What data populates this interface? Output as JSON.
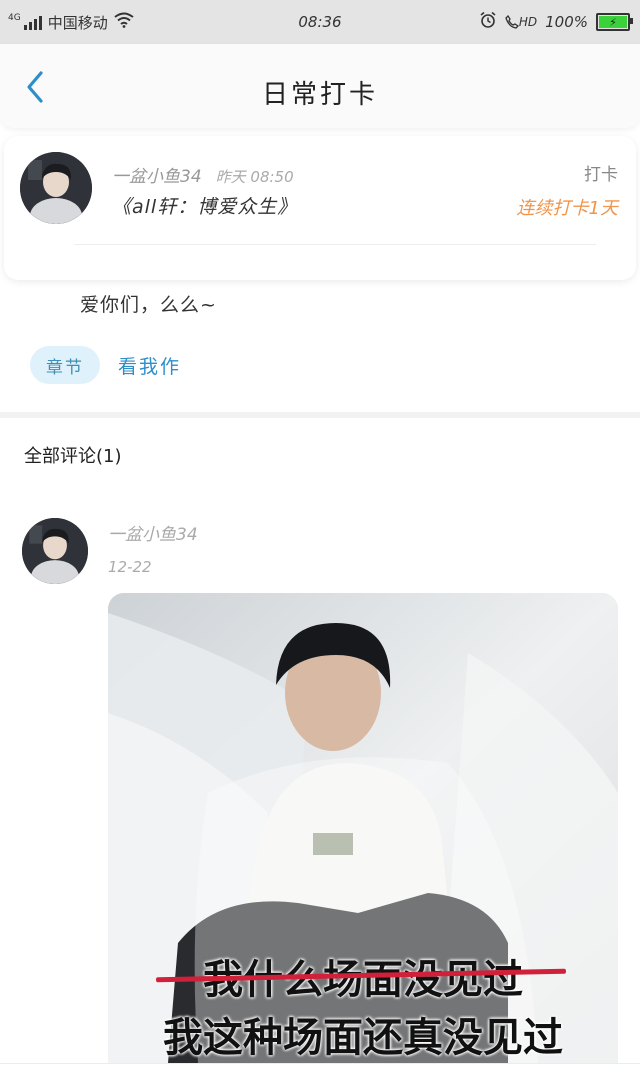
{
  "status_bar": {
    "network": "4G",
    "carrier": "中国移动",
    "time": "08:36",
    "hd": "HD",
    "battery": "100%"
  },
  "nav": {
    "title": "日常打卡"
  },
  "checkin_card": {
    "username": "一盆小鱼34",
    "time": "昨天 08:50",
    "book": "《all轩：博爱众生》",
    "action": "打卡",
    "streak": "连续打卡1天"
  },
  "post": {
    "content": "爱你们，么么~",
    "tag": "章节",
    "chapter_link": "看我作"
  },
  "comments": {
    "header": "全部评论(1)",
    "items": [
      {
        "username": "一盆小鱼34",
        "date": "12-22",
        "image": {
          "caption_struck": "我什么场面没见过",
          "caption": "我这种场面还真没见过"
        }
      }
    ]
  },
  "colors": {
    "accent_blue": "#2e8ec9",
    "streak_orange": "#f0954c",
    "battery_green": "#3ad13a",
    "strike_red": "#d0203a"
  }
}
